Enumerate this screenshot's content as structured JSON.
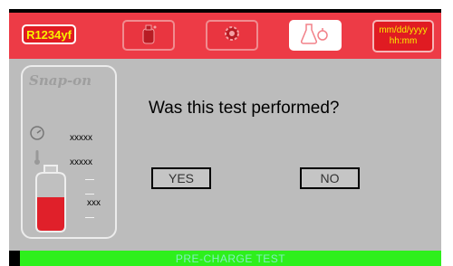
{
  "header": {
    "refrigerant": "R1234yf",
    "tabs": [
      {
        "icon": "bottle-icon",
        "active": false
      },
      {
        "icon": "gear-icon",
        "active": false
      },
      {
        "icon": "flask-icon",
        "active": true
      }
    ],
    "date": "mm/dd/yyyy",
    "time": "hh:mm"
  },
  "side": {
    "brand": "Snap-on",
    "pressure_value": "xxxxx",
    "temperature_value": "xxxxx",
    "level_value": "xxx"
  },
  "dialog": {
    "question": "Was this test performed?",
    "yes_label": "YES",
    "no_label": "NO"
  },
  "status": {
    "label": "PRE-CHARGE TEST"
  },
  "colors": {
    "header_red": "#ed3b46",
    "accent_yellow": "#f8f000",
    "panel_gray": "#bcbcbc",
    "status_green": "#2eef1c",
    "tank_red": "#e0202a"
  }
}
